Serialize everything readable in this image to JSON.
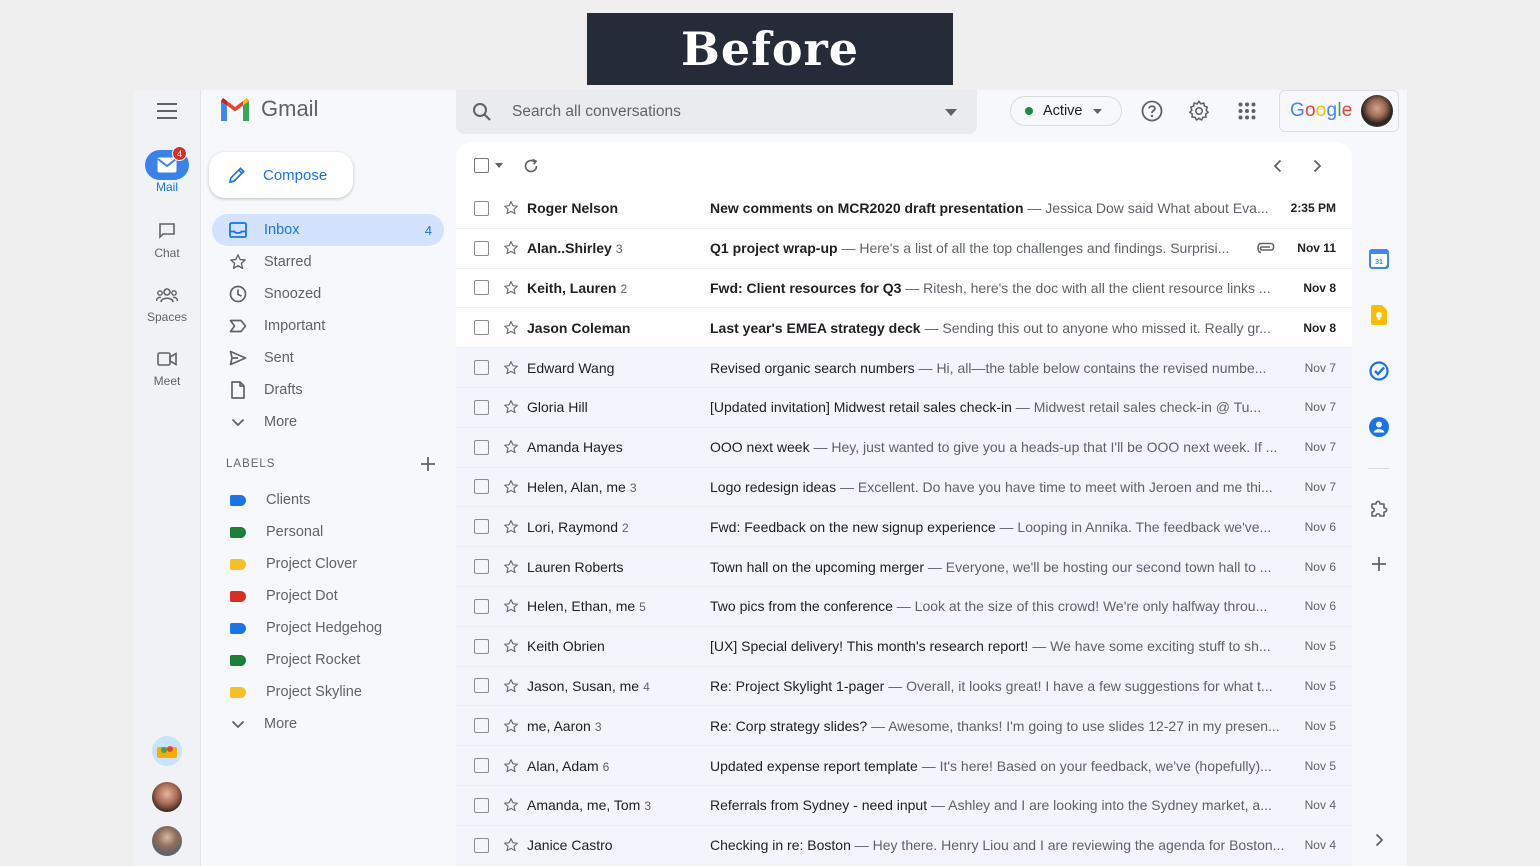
{
  "banner": {
    "text": "Before"
  },
  "app": {
    "name": "Gmail"
  },
  "rail": {
    "mail": {
      "label": "Mail",
      "badge": "4"
    },
    "chat": {
      "label": "Chat"
    },
    "spaces": {
      "label": "Spaces"
    },
    "meet": {
      "label": "Meet"
    }
  },
  "compose": {
    "label": "Compose"
  },
  "nav": {
    "items": [
      {
        "label": "Inbox",
        "count": "4"
      },
      {
        "label": "Starred"
      },
      {
        "label": "Snoozed"
      },
      {
        "label": "Important"
      },
      {
        "label": "Sent"
      },
      {
        "label": "Drafts"
      },
      {
        "label": "More"
      }
    ]
  },
  "labels": {
    "header": "LABELS",
    "items": [
      {
        "label": "Clients",
        "color": "#1a73e8"
      },
      {
        "label": "Personal",
        "color": "#188038"
      },
      {
        "label": "Project Clover",
        "color": "#f6bf26"
      },
      {
        "label": "Project Dot",
        "color": "#d93025"
      },
      {
        "label": "Project Hedgehog",
        "color": "#1a73e8"
      },
      {
        "label": "Project Rocket",
        "color": "#188038"
      },
      {
        "label": "Project Skyline",
        "color": "#f6bf26"
      }
    ],
    "more": "More"
  },
  "search": {
    "placeholder": "Search all conversations"
  },
  "status": {
    "label": "Active",
    "color": "#1e8e3e"
  },
  "account": {
    "brand": "Google"
  },
  "emails": [
    {
      "sender": "Roger Nelson",
      "count": "",
      "subject": "New comments on MCR2020 draft presentation",
      "snippet": "Jessica Dow said What about Eva...",
      "date": "2:35 PM",
      "unread": true
    },
    {
      "sender": "Alan..Shirley",
      "count": "3",
      "subject": "Q1 project wrap-up ",
      "snippet": "Here's a list of all the top challenges and findings. Surprisi...",
      "date": "Nov 11",
      "unread": true,
      "attachment": true
    },
    {
      "sender": "Keith, Lauren",
      "count": "2",
      "subject": "Fwd: Client resources for Q3",
      "snippet": "Ritesh, here's the doc with all the client resource links ...",
      "date": "Nov 8",
      "unread": true
    },
    {
      "sender": "Jason Coleman",
      "count": "",
      "subject": "Last year's EMEA strategy deck",
      "snippet": "Sending this out to anyone who missed it. Really gr...",
      "date": "Nov 8",
      "unread": true
    },
    {
      "sender": "Edward Wang",
      "count": "",
      "subject": "Revised organic search numbers",
      "snippet": "Hi, all—the table below contains the revised numbe...",
      "date": "Nov 7",
      "unread": false
    },
    {
      "sender": "Gloria Hill",
      "count": "",
      "subject": "[Updated invitation] Midwest retail sales check-in",
      "snippet": "Midwest retail sales check-in @ Tu...",
      "date": "Nov 7",
      "unread": false
    },
    {
      "sender": "Amanda Hayes",
      "count": "",
      "subject": "OOO next week",
      "snippet": "Hey, just wanted to give you a heads-up that I'll be OOO next week. If ...",
      "date": "Nov 7",
      "unread": false
    },
    {
      "sender": "Helen, Alan, me",
      "count": "3",
      "subject": "Logo redesign ideas",
      "snippet": "Excellent. Do have you have time to meet with Jeroen and me thi...",
      "date": "Nov 7",
      "unread": false
    },
    {
      "sender": "Lori, Raymond",
      "count": "2",
      "subject": "Fwd: Feedback on the new signup experience",
      "snippet": "Looping in Annika. The feedback we've...",
      "date": "Nov 6",
      "unread": false
    },
    {
      "sender": "Lauren Roberts",
      "count": "",
      "subject": "Town hall on the upcoming merger",
      "snippet": "Everyone, we'll be hosting our second town hall to ...",
      "date": "Nov 6",
      "unread": false
    },
    {
      "sender": "Helen, Ethan, me",
      "count": "5",
      "subject": "Two pics from the conference",
      "snippet": "Look at the size of this crowd! We're only halfway throu...",
      "date": "Nov 6",
      "unread": false
    },
    {
      "sender": "Keith Obrien",
      "count": "",
      "subject": "[UX] Special delivery! This month's research report!",
      "snippet": "We have some exciting stuff to sh...",
      "date": "Nov 5",
      "unread": false
    },
    {
      "sender": "Jason, Susan, me",
      "count": "4",
      "subject": "Re: Project Skylight 1-pager",
      "snippet": "Overall, it looks great! I have a few suggestions for what t...",
      "date": "Nov 5",
      "unread": false
    },
    {
      "sender": "me, Aaron",
      "count": "3",
      "subject": "Re: Corp strategy slides?",
      "snippet": "Awesome, thanks! I'm going to use slides 12-27 in my presen...",
      "date": "Nov 5",
      "unread": false
    },
    {
      "sender": "Alan, Adam",
      "count": "6",
      "subject": "Updated expense report template",
      "snippet": "It's here! Based on your feedback, we've (hopefully)...",
      "date": "Nov 5",
      "unread": false
    },
    {
      "sender": "Amanda, me, Tom",
      "count": "3",
      "subject": "Referrals from Sydney - need input",
      "snippet": "Ashley and I are looking into the Sydney market, a...",
      "date": "Nov 4",
      "unread": false
    },
    {
      "sender": "Janice Castro",
      "count": "",
      "subject": "Checking in re: Boston",
      "snippet": "Hey there. Henry Liou and I are reviewing the agenda for Boston...",
      "date": "Nov 4",
      "unread": false
    }
  ]
}
